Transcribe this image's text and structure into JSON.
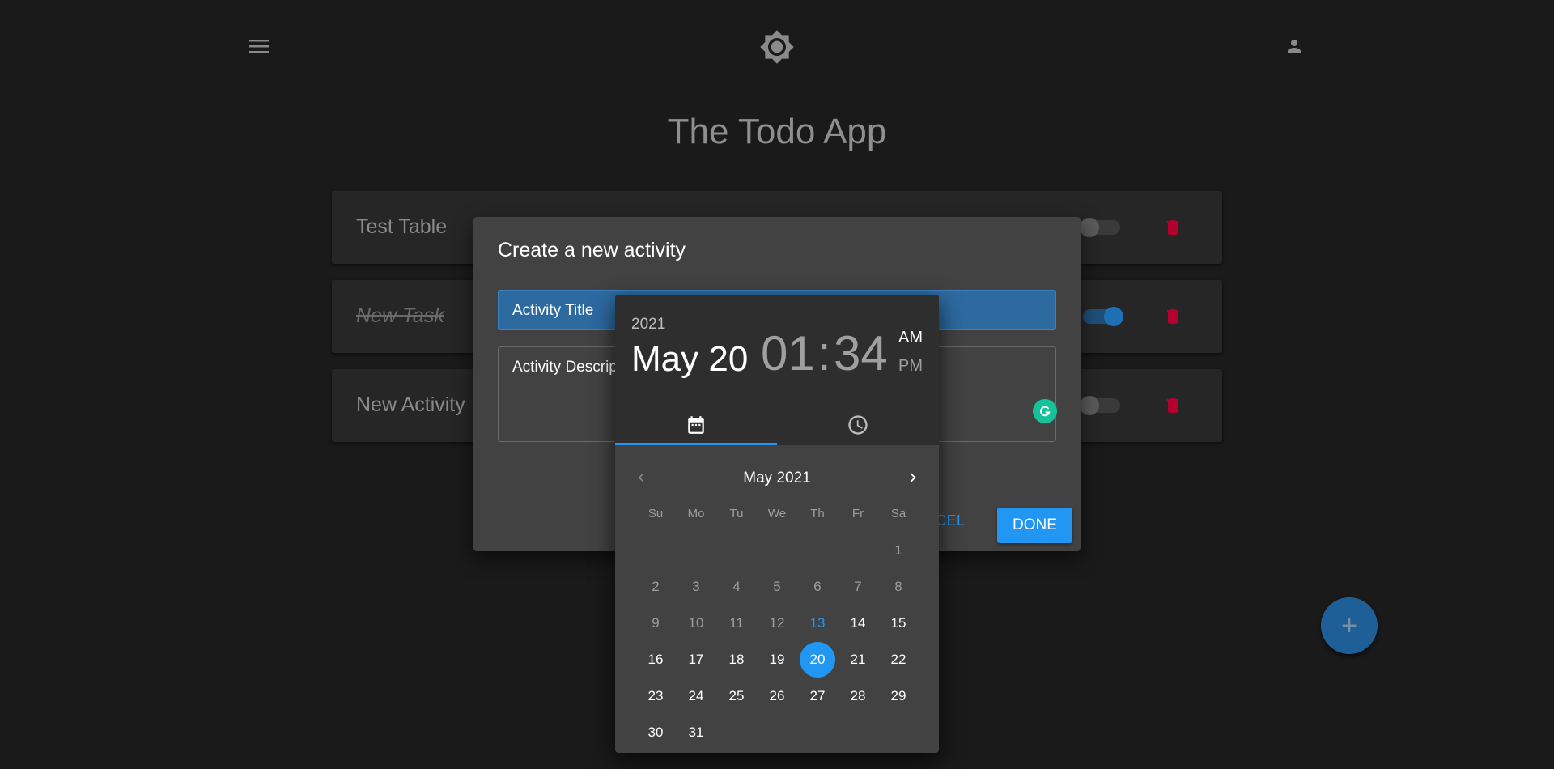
{
  "header": {
    "menu_icon": "menu-icon",
    "theme_icon": "brightness-icon",
    "account_icon": "account-icon"
  },
  "app": {
    "title": "The Todo App"
  },
  "todos": [
    {
      "label": "Test Table",
      "completed": false,
      "toggle_on": false
    },
    {
      "label": "New Task",
      "completed": true,
      "toggle_on": true
    },
    {
      "label": "New Activity",
      "completed": false,
      "toggle_on": false
    }
  ],
  "fab": {
    "label": "+"
  },
  "dialog": {
    "title": "Create a new activity",
    "title_field": "Activity Title",
    "description_field": "Activity Descrip",
    "cancel_label": "ANCEL",
    "done_label": "DONE"
  },
  "picker": {
    "year": "2021",
    "date": "May 20",
    "hour": "01",
    "colon": ":",
    "minute": "34",
    "am": "AM",
    "pm": "PM",
    "month_label": "May 2021",
    "weekdays": [
      "Su",
      "Mo",
      "Tu",
      "We",
      "Th",
      "Fr",
      "Sa"
    ],
    "days": [
      "",
      "",
      "",
      "",
      "",
      "",
      "1",
      "2",
      "3",
      "4",
      "5",
      "6",
      "7",
      "8",
      "9",
      "10",
      "11",
      "12",
      "13",
      "14",
      "15",
      "16",
      "17",
      "18",
      "19",
      "20",
      "21",
      "22",
      "23",
      "24",
      "25",
      "26",
      "27",
      "28",
      "29",
      "30",
      "31"
    ],
    "today": "13",
    "selected": "20"
  },
  "colors": {
    "accent": "#2196f3",
    "danger": "#c2003a",
    "background": "#1a1a1a"
  }
}
